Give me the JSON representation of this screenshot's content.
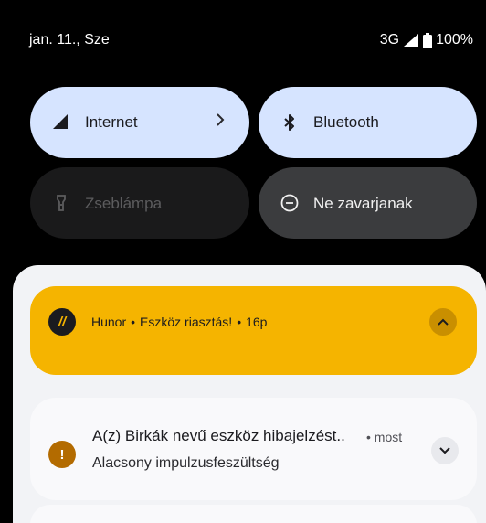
{
  "status_bar": {
    "date": "jan. 11., Sze",
    "network": "3G",
    "battery": "100%"
  },
  "quick_settings": {
    "internet": {
      "label": "Internet",
      "icon": "signal-icon",
      "active": true
    },
    "bluetooth": {
      "label": "Bluetooth",
      "icon": "bluetooth-icon",
      "active": true
    },
    "flashlight": {
      "label": "Zseblámpa",
      "icon": "flashlight-icon",
      "active": false
    },
    "dnd": {
      "label": "Ne zavarjanak",
      "icon": "do-not-disturb-icon",
      "active": false
    }
  },
  "notifications": [
    {
      "app": "Hunor",
      "title": "Eszköz riasztás!",
      "time": "16p",
      "color": "#f5b400",
      "expanded": true
    },
    {
      "title": "A(z) Birkák nevű eszköz hibajelzést..",
      "time": "most",
      "text": "Alacsony impulzusfeszültség",
      "color": "#b36b00",
      "expanded": false
    }
  ],
  "colors": {
    "active_tile": "#d6e4ff",
    "inactive_tile": "#3b3c3e",
    "disabled_tile": "#1a1a1b",
    "shade_bg": "#f2f3f6"
  }
}
